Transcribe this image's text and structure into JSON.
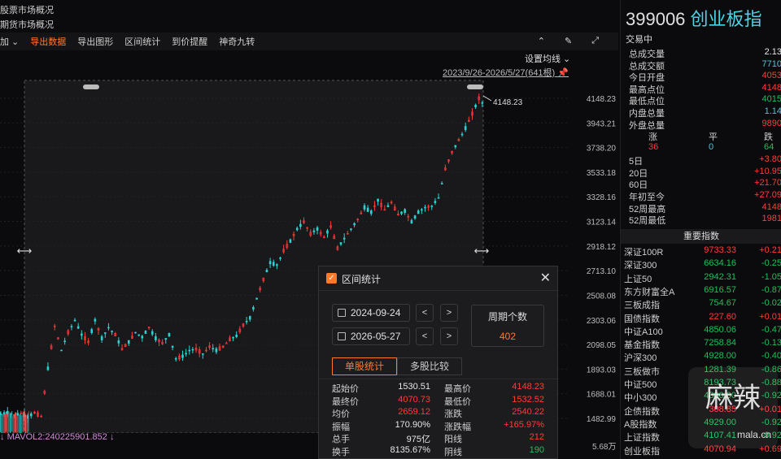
{
  "left_top": {
    "line1": "股票市场概况",
    "line2": "期货市场概况"
  },
  "toolbar": {
    "items": [
      "加",
      "导出数据",
      "导出图形",
      "区间统计",
      "到价提醒",
      "神奇九转"
    ],
    "set_ma": "设置均线",
    "range_label": "2023/9/26-2026/5/27(641根)"
  },
  "chart_data": {
    "type": "candlestick",
    "y_ticks": [
      "4148.23",
      "3943.21",
      "3738.20",
      "3533.18",
      "3328.16",
      "3123.14",
      "2918.12",
      "2713.10",
      "2508.08",
      "2303.06",
      "2098.05",
      "1893.03",
      "1688.01",
      "1482.99"
    ],
    "ylim": [
      1482.99,
      4148.23
    ],
    "high_label": "4148.23",
    "path": [
      [
        0,
        1520
      ],
      [
        4,
        1530
      ],
      [
        8,
        1510
      ],
      [
        12,
        1525
      ],
      [
        16,
        1495
      ],
      [
        20,
        1530
      ],
      [
        24,
        1500
      ],
      [
        28,
        1900
      ],
      [
        32,
        2250
      ],
      [
        36,
        2050
      ],
      [
        40,
        2200
      ],
      [
        44,
        2300
      ],
      [
        48,
        2180
      ],
      [
        52,
        2120
      ],
      [
        56,
        2300
      ],
      [
        60,
        2150
      ],
      [
        64,
        2240
      ],
      [
        68,
        2180
      ],
      [
        72,
        2060
      ],
      [
        76,
        2120
      ],
      [
        80,
        2200
      ],
      [
        84,
        2160
      ],
      [
        88,
        2240
      ],
      [
        92,
        2150
      ],
      [
        96,
        2110
      ],
      [
        100,
        2180
      ],
      [
        104,
        1980
      ],
      [
        108,
        2000
      ],
      [
        112,
        2050
      ],
      [
        116,
        2060
      ],
      [
        120,
        2020
      ],
      [
        124,
        2080
      ],
      [
        128,
        2050
      ],
      [
        132,
        2080
      ],
      [
        136,
        2140
      ],
      [
        140,
        2170
      ],
      [
        144,
        2260
      ],
      [
        148,
        2320
      ],
      [
        152,
        2480
      ],
      [
        156,
        2640
      ],
      [
        160,
        2780
      ],
      [
        164,
        2760
      ],
      [
        168,
        2880
      ],
      [
        172,
        2960
      ],
      [
        176,
        3060
      ],
      [
        180,
        3120
      ],
      [
        184,
        3020
      ],
      [
        188,
        3060
      ],
      [
        192,
        2990
      ],
      [
        196,
        3080
      ],
      [
        200,
        2900
      ],
      [
        204,
        2980
      ],
      [
        208,
        3060
      ],
      [
        212,
        3140
      ],
      [
        216,
        3240
      ],
      [
        220,
        3200
      ],
      [
        224,
        3300
      ],
      [
        228,
        3220
      ],
      [
        232,
        3280
      ],
      [
        236,
        3180
      ],
      [
        240,
        3210
      ],
      [
        244,
        3120
      ],
      [
        248,
        3200
      ],
      [
        252,
        3240
      ],
      [
        256,
        3250
      ],
      [
        260,
        3320
      ],
      [
        264,
        3560
      ],
      [
        268,
        3700
      ],
      [
        272,
        3800
      ],
      [
        276,
        3900
      ],
      [
        280,
        4020
      ],
      [
        284,
        4148
      ],
      [
        288,
        4071
      ]
    ]
  },
  "mavol_label": "MAVOL2:240225901.852",
  "bottom_right_pct": "5.68万",
  "right": {
    "code": "399006",
    "name": "创业板指",
    "status": "交易中",
    "stats": [
      {
        "k": "总成交量",
        "v": "2.13",
        "c": "white"
      },
      {
        "k": "总成交额",
        "v": "7710",
        "c": "cyan"
      },
      {
        "k": "今日开盘",
        "v": "4053",
        "c": "red"
      },
      {
        "k": "最高点位",
        "v": "4148",
        "c": "red"
      },
      {
        "k": "最低点位",
        "v": "4015",
        "c": "green"
      },
      {
        "k": "内盘总量",
        "v": "1.14",
        "c": "cyan"
      },
      {
        "k": "外盘总量",
        "v": "9890",
        "c": "red"
      }
    ],
    "updown": {
      "h": [
        "涨",
        "平",
        "跌"
      ],
      "v": [
        "36",
        "0",
        "64"
      ]
    },
    "perf": [
      {
        "k": "5日",
        "v": "+3.80"
      },
      {
        "k": "20日",
        "v": "+10.95"
      },
      {
        "k": "60日",
        "v": "+21.70"
      },
      {
        "k": "年初至今",
        "v": "+27.09"
      },
      {
        "k": "52周最高",
        "v": "4148"
      },
      {
        "k": "52周最低",
        "v": "1981"
      }
    ],
    "index_head": "重要指数",
    "indices": [
      {
        "n": "深证100R",
        "p": "9733.33",
        "c": "+0.21",
        "up": true
      },
      {
        "n": "深证300",
        "p": "6634.16",
        "c": "-0.25",
        "up": false
      },
      {
        "n": "上证50",
        "p": "2942.31",
        "c": "-1.05",
        "up": false
      },
      {
        "n": "东方财富全A",
        "p": "6916.57",
        "c": "-0.87",
        "up": false
      },
      {
        "n": "三板成指",
        "p": "754.67",
        "c": "-0.02",
        "up": false
      },
      {
        "n": "国债指数",
        "p": "227.60",
        "c": "+0.01",
        "up": true
      },
      {
        "n": "中证A100",
        "p": "4850.06",
        "c": "-0.47",
        "up": false
      },
      {
        "n": "基金指数",
        "p": "7258.84",
        "c": "-0.13",
        "up": false
      },
      {
        "n": "沪深300",
        "p": "4928.00",
        "c": "-0.40",
        "up": false
      },
      {
        "n": "三板做市",
        "p": "1281.39",
        "c": "-0.86",
        "up": false
      },
      {
        "n": "中证500",
        "p": "8193.73",
        "c": "-0.88",
        "up": false
      },
      {
        "n": "中小300",
        "p": "4880.00",
        "c": "-0.92",
        "up": false
      },
      {
        "n": "企债指数",
        "p": "308.85",
        "c": "+0.01",
        "up": true
      },
      {
        "n": "A股指数",
        "p": "4929.00",
        "c": "-0.92",
        "up": false
      },
      {
        "n": "上证指数",
        "p": "4107.41",
        "c": "-0.92",
        "up": false
      },
      {
        "n": "创业板指",
        "p": "4070.94",
        "c": "+0.69",
        "up": true
      }
    ]
  },
  "modal": {
    "title": "区间统计",
    "start_date": "2024-09-24",
    "end_date": "2026-05-27",
    "period_label": "周期个数",
    "period_value": "402",
    "tab1": "单股统计",
    "tab2": "多股比较",
    "stats_left": [
      {
        "k": "起始价",
        "v": "1530.51",
        "c": "white"
      },
      {
        "k": "最终价",
        "v": "4070.73",
        "c": "red"
      },
      {
        "k": "均价",
        "v": "2659.12",
        "c": "red"
      },
      {
        "k": "振幅",
        "v": "170.90%",
        "c": "white"
      },
      {
        "k": "总手",
        "v": "975亿",
        "c": "white"
      },
      {
        "k": "换手",
        "v": "8135.67%",
        "c": "white"
      }
    ],
    "stats_right": [
      {
        "k": "最高价",
        "v": "4148.23",
        "c": "red"
      },
      {
        "k": "最低价",
        "v": "1532.52",
        "c": "red"
      },
      {
        "k": "涨跌",
        "v": "2540.22",
        "c": "red"
      },
      {
        "k": "涨跌幅",
        "v": "+165.97%",
        "c": "red"
      },
      {
        "k": "阳线",
        "v": "212",
        "c": "red"
      },
      {
        "k": "阴线",
        "v": "190",
        "c": "green"
      }
    ]
  },
  "watermark": {
    "text": "麻辣",
    "sub": "mala.cn"
  }
}
